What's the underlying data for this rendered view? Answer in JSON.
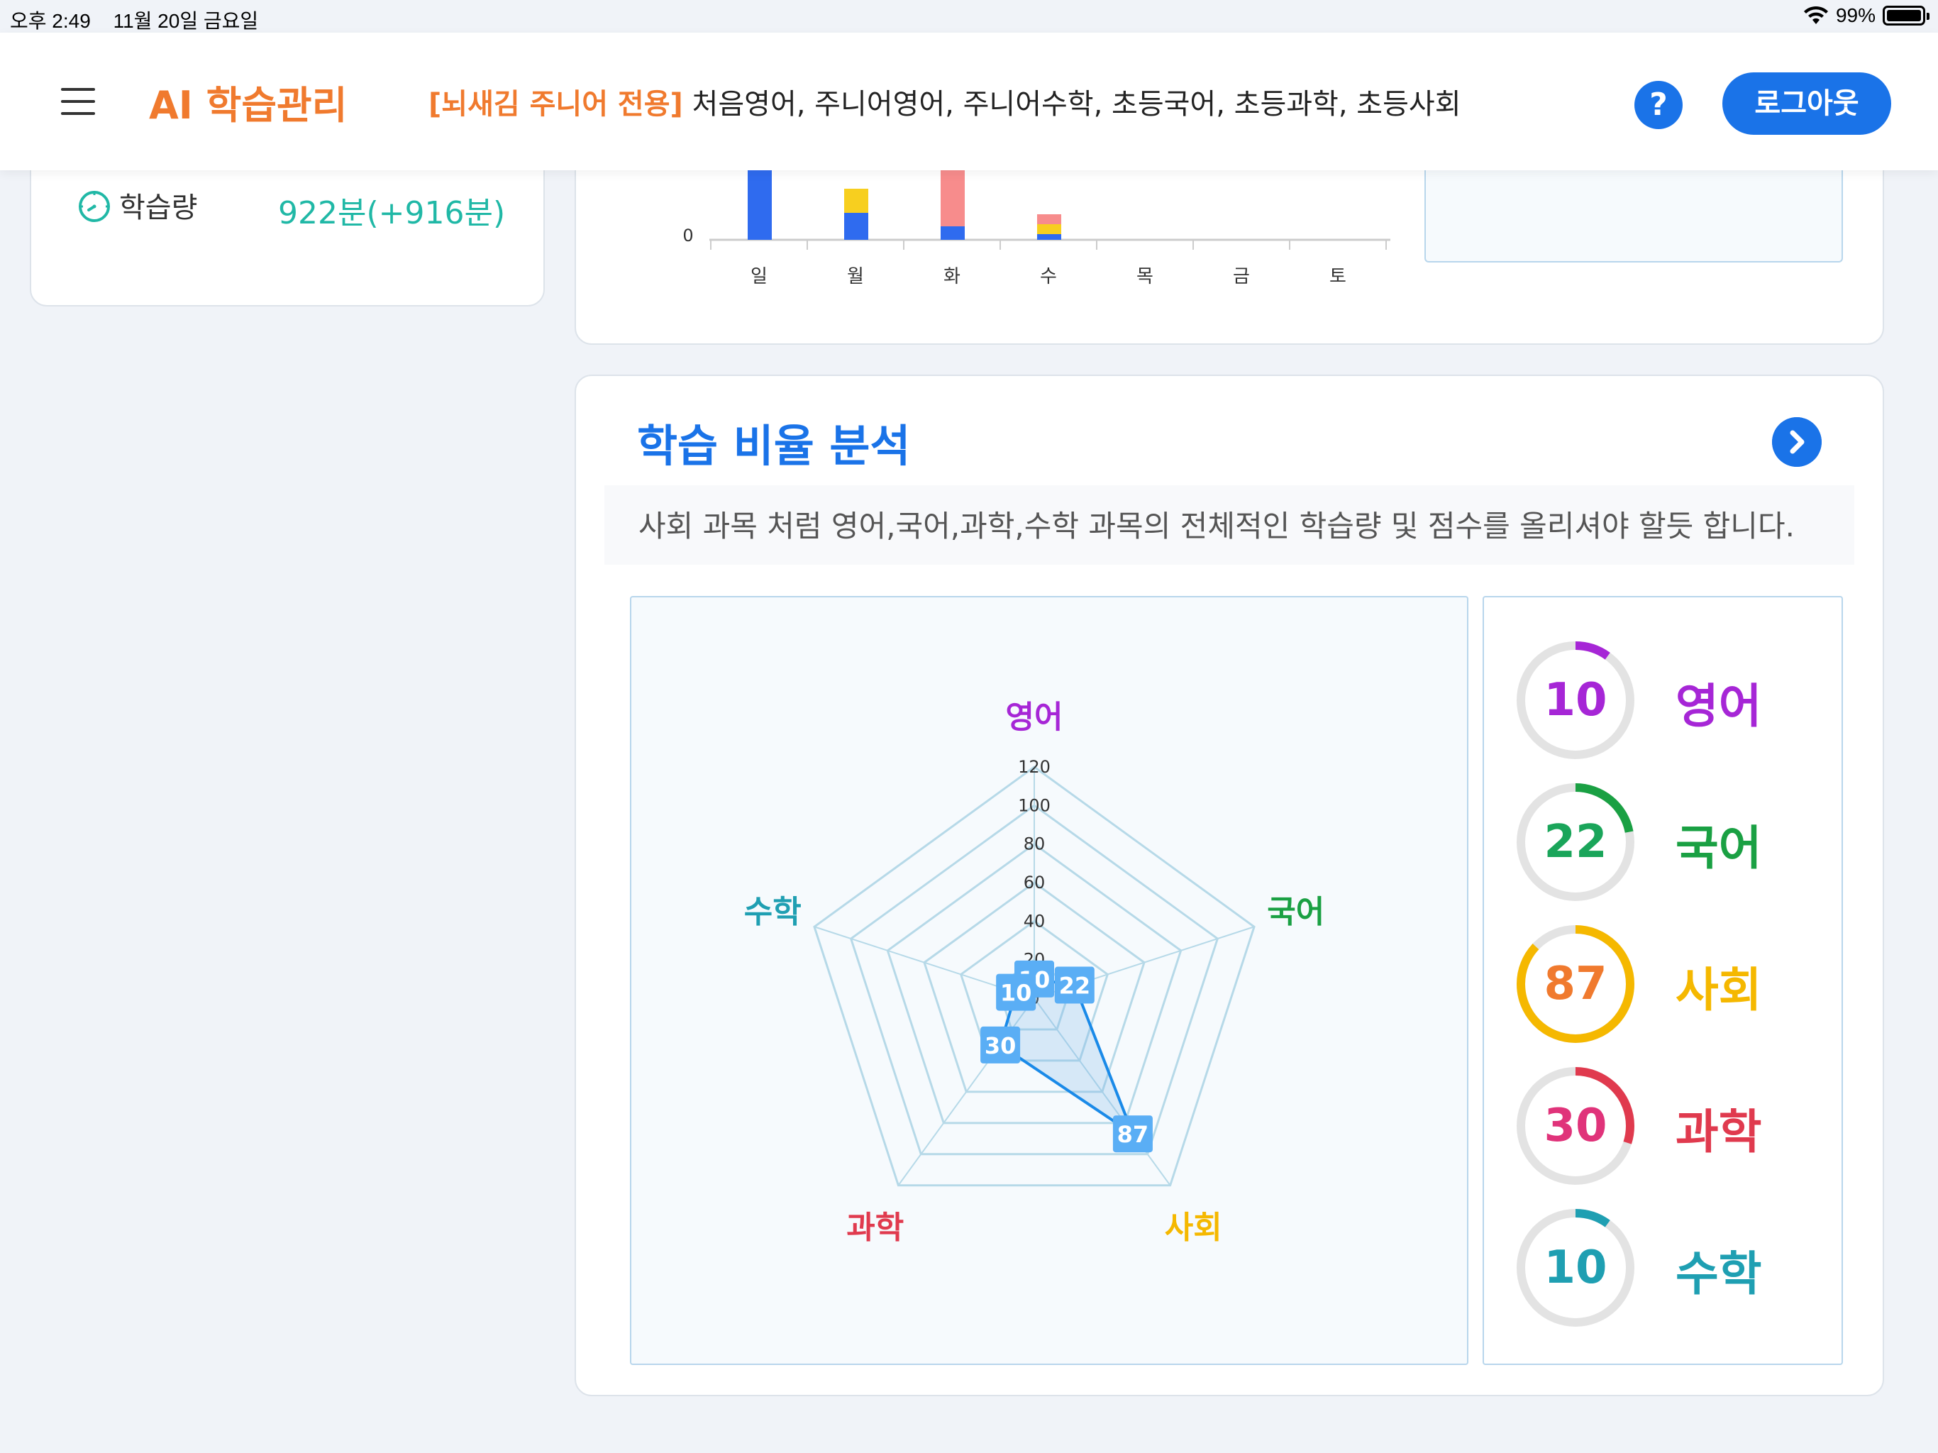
{
  "status_bar": {
    "time": "오후 2:49",
    "date": "11월 20일 금요일",
    "battery": "99%"
  },
  "header": {
    "app_title": "AI 학습관리",
    "subtitle_highlight": "[뇌새김 주니어 전용]",
    "subtitle_rest": " 처음영어, 주니어영어, 주니어수학, 초등국어, 초등과학, 초등사회",
    "help_label": "?",
    "logout_label": "로그아웃"
  },
  "summary": {
    "study_label": "학습량",
    "study_value": "922분(+916분)",
    "icon": "clock-icon"
  },
  "weekly_chart": {
    "y_tick_zero": "0",
    "days": [
      "일",
      "월",
      "화",
      "수",
      "목",
      "금",
      "토"
    ],
    "colors": {
      "blue": "#2f6bef",
      "yellow": "#f7cf1f",
      "red": "#f78c8c"
    }
  },
  "analysis": {
    "title": "학습 비율 분석",
    "comment": "사회 과목 처럼 영어,국어,과학,수학 과목의 전체적인 학습량 및 점수를 올리셔야 할듯 합니다."
  },
  "chart_data": {
    "type": "radar",
    "axes": [
      "영어",
      "국어",
      "사회",
      "과학",
      "수학"
    ],
    "values": [
      10,
      22,
      87,
      30,
      10
    ],
    "r_ticks": [
      "0",
      "20",
      "40",
      "60",
      "80",
      "100",
      "120"
    ],
    "r_range": [
      0,
      120
    ],
    "axis_colors": [
      "#a626d6",
      "#1aa043",
      "#f5b800",
      "#e03a4e",
      "#1f9fb2"
    ]
  },
  "scores": [
    {
      "subject": "영어",
      "value": 10,
      "num_color": "#a626d6",
      "label_color": "#a626d6",
      "ring_color": "#a626d6"
    },
    {
      "subject": "국어",
      "value": 22,
      "num_color": "#1aa55a",
      "label_color": "#1aa043",
      "ring_color": "#1aa043"
    },
    {
      "subject": "사회",
      "value": 87,
      "num_color": "#f07a2e",
      "label_color": "#f5b800",
      "ring_color": "#f5b800"
    },
    {
      "subject": "과학",
      "value": 30,
      "num_color": "#e0337a",
      "label_color": "#e03a4e",
      "ring_color": "#e03a4e"
    },
    {
      "subject": "수학",
      "value": 10,
      "num_color": "#1f9fb2",
      "label_color": "#1f9fb2",
      "ring_color": "#1f9fb2"
    }
  ]
}
